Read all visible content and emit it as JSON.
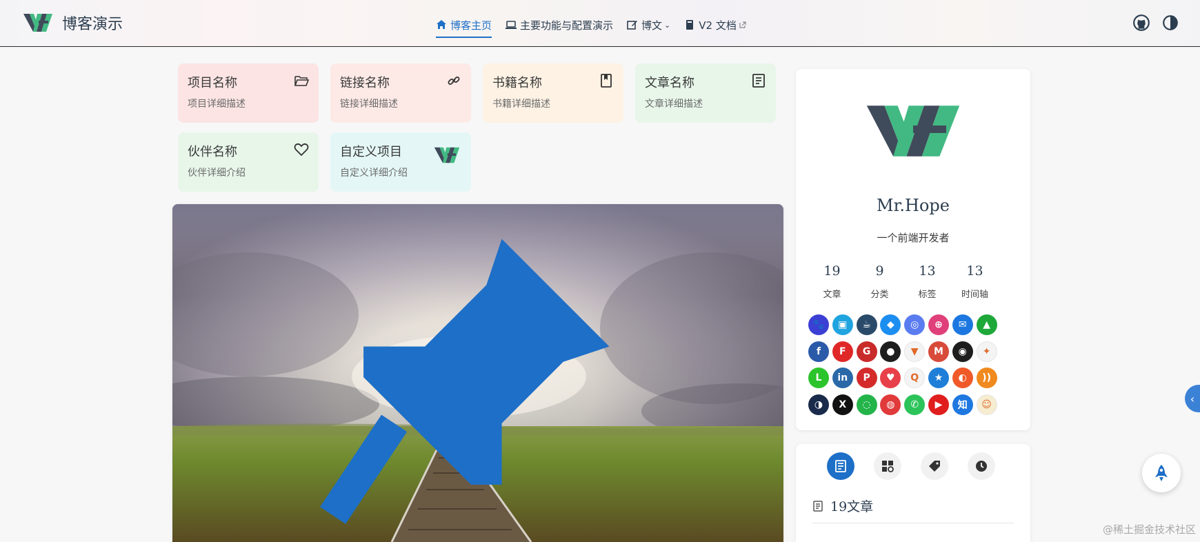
{
  "navbar": {
    "brand_title": "博客演示",
    "links": [
      {
        "label": "博客主页",
        "icon": "home-icon",
        "active": true
      },
      {
        "label": "主要功能与配置演示",
        "icon": "laptop-icon"
      },
      {
        "label": "博文",
        "icon": "edit-icon",
        "dropdown": true
      },
      {
        "label": "V2 文档",
        "icon": "book-icon",
        "external": true
      }
    ],
    "right_icons": [
      "github-icon",
      "theme-toggle-icon"
    ]
  },
  "projects": [
    {
      "name": "项目名称",
      "desc": "项目详细描述",
      "icon": "folder-open-icon",
      "bg": "#fbe3e3"
    },
    {
      "name": "链接名称",
      "desc": "链接详细描述",
      "icon": "link-icon",
      "bg": "#fde8e6"
    },
    {
      "name": "书籍名称",
      "desc": "书籍详细描述",
      "icon": "book-icon",
      "bg": "#fdf1e3"
    },
    {
      "name": "文章名称",
      "desc": "文章详细描述",
      "icon": "article-icon",
      "bg": "#e6f6ea"
    },
    {
      "name": "伙伴名称",
      "desc": "伙伴详细介绍",
      "icon": "heart-icon",
      "bg": "#e6f6ea"
    },
    {
      "name": "自定义项目",
      "desc": "自定义详细介绍",
      "icon": "vh-logo-icon",
      "bg": "#e3f7f6"
    }
  ],
  "hero": {
    "pinned": true,
    "icon": "pin-icon"
  },
  "profile": {
    "name": "Mr.Hope",
    "description": "一个前端开发者",
    "stats": [
      {
        "num": "19",
        "label": "文章"
      },
      {
        "num": "9",
        "label": "分类"
      },
      {
        "num": "13",
        "label": "标签"
      },
      {
        "num": "13",
        "label": "时间轴"
      }
    ],
    "socials": [
      {
        "name": "baidu-icon",
        "color": "#3b3fd4",
        "glyph": "🐾"
      },
      {
        "name": "bilibili-icon",
        "color": "#1fa4e0",
        "glyph": "▣"
      },
      {
        "name": "buymeacoffee-icon",
        "color": "#2a4a6a",
        "glyph": "☕"
      },
      {
        "name": "dingding-icon",
        "color": "#1c8ef0",
        "glyph": "◆"
      },
      {
        "name": "discord-icon",
        "color": "#5a7cf0",
        "glyph": "◎"
      },
      {
        "name": "dribbble-icon",
        "color": "#e0407a",
        "glyph": "⊕"
      },
      {
        "name": "email-icon",
        "color": "#1c78e0",
        "glyph": "✉"
      },
      {
        "name": "evernote-icon",
        "color": "#1ea83a",
        "glyph": "▲"
      },
      {
        "name": "facebook-icon",
        "color": "#2b5aa8",
        "glyph": "f"
      },
      {
        "name": "flipboard-icon",
        "color": "#e02828",
        "glyph": "F"
      },
      {
        "name": "gitee-icon",
        "color": "#c92a2a",
        "glyph": "G"
      },
      {
        "name": "github-icon",
        "color": "#1e1e1e",
        "glyph": "●"
      },
      {
        "name": "gitlab-icon",
        "color": "#f4f4f4",
        "glyph": "▼"
      },
      {
        "name": "gmail-icon",
        "color": "#d84a3a",
        "glyph": "M"
      },
      {
        "name": "instagram-icon",
        "color": "#1e1e1e",
        "glyph": "◉"
      },
      {
        "name": "lark-icon",
        "color": "#f4f4f4",
        "glyph": "✦"
      },
      {
        "name": "line-icon",
        "color": "#2cc42c",
        "glyph": "L"
      },
      {
        "name": "linkedin-icon",
        "color": "#2a68a8",
        "glyph": "in"
      },
      {
        "name": "pinterest-icon",
        "color": "#d42a2a",
        "glyph": "P"
      },
      {
        "name": "pocket-icon",
        "color": "#e8404a",
        "glyph": "♥"
      },
      {
        "name": "qq-icon",
        "color": "#f4f4f4",
        "glyph": "Q"
      },
      {
        "name": "qzone-icon",
        "color": "#1e7ed8",
        "glyph": "★"
      },
      {
        "name": "reddit-icon",
        "color": "#f05a28",
        "glyph": "◐"
      },
      {
        "name": "rss-icon",
        "color": "#f08a1e",
        "glyph": "))"
      },
      {
        "name": "steam-icon",
        "color": "#1a2a4a",
        "glyph": "◑"
      },
      {
        "name": "twitter-x-icon",
        "color": "#111111",
        "glyph": "X"
      },
      {
        "name": "wechat-icon",
        "color": "#23b44a",
        "glyph": "◌"
      },
      {
        "name": "weibo-icon",
        "color": "#e03a3a",
        "glyph": "◍"
      },
      {
        "name": "whatsapp-icon",
        "color": "#2cc45a",
        "glyph": "✆"
      },
      {
        "name": "youtube-icon",
        "color": "#e01e1e",
        "glyph": "▶"
      },
      {
        "name": "zhihu-icon",
        "color": "#1e78e0",
        "glyph": "知"
      },
      {
        "name": "custom-avatar-icon",
        "color": "#f6ecd0",
        "glyph": "☺"
      }
    ]
  },
  "info_card": {
    "tabs": [
      {
        "icon": "article-icon",
        "active": true
      },
      {
        "icon": "category-icon"
      },
      {
        "icon": "tag-icon"
      },
      {
        "icon": "timeline-icon"
      }
    ],
    "title": "19文章"
  },
  "floaters": {
    "side_toggle_glyph": "‹",
    "rocket_icon": "rocket-icon"
  },
  "watermark": "@稀土掘金技术社区"
}
